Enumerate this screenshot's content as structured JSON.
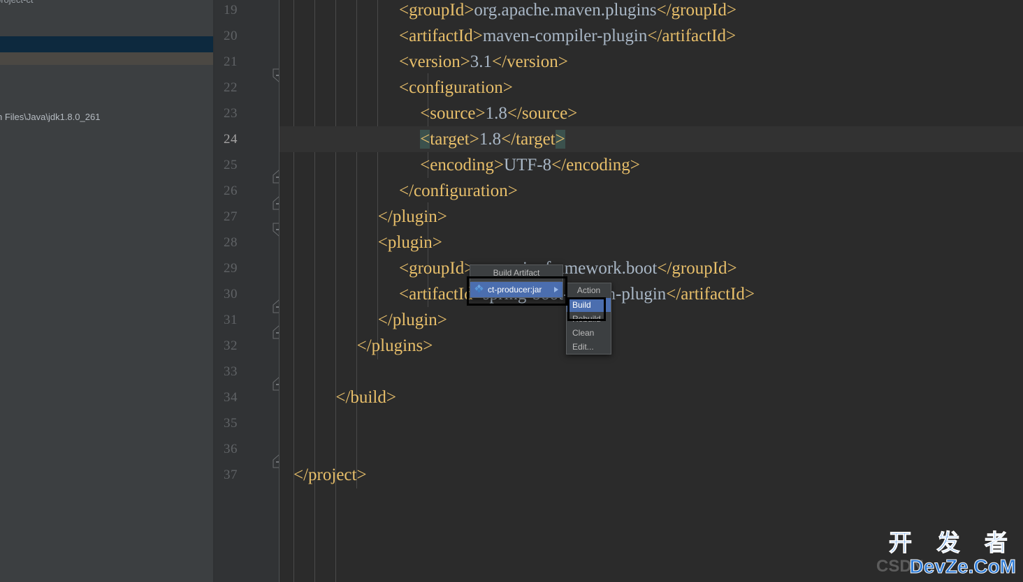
{
  "left_panel": {
    "clipped_tree_label": "project-ct",
    "sdk_path_label": "n Files\\Java\\jdk1.8.0_261"
  },
  "editor": {
    "lines": [
      {
        "num": "19",
        "indent": 5,
        "clipped": true,
        "segments": [
          {
            "t": "<groupId>",
            "c": "tag"
          },
          {
            "t": "org.apache.maven.plugins",
            "c": "txt"
          },
          {
            "t": "</groupId>",
            "c": "tag"
          }
        ]
      },
      {
        "num": "20",
        "indent": 5,
        "segments": [
          {
            "t": "<artifactId>",
            "c": "tag"
          },
          {
            "t": "maven-compiler-plugin",
            "c": "txt"
          },
          {
            "t": "</artifactId>",
            "c": "tag"
          }
        ]
      },
      {
        "num": "21",
        "indent": 5,
        "segments": [
          {
            "t": "<version>",
            "c": "tag"
          },
          {
            "t": "3.1",
            "c": "txt"
          },
          {
            "t": "</version>",
            "c": "tag"
          }
        ]
      },
      {
        "num": "22",
        "indent": 5,
        "segments": [
          {
            "t": "<configuration>",
            "c": "tag"
          }
        ]
      },
      {
        "num": "23",
        "indent": 6,
        "segments": [
          {
            "t": "<source>",
            "c": "tag"
          },
          {
            "t": "1.8",
            "c": "txt"
          },
          {
            "t": "</source>",
            "c": "tag"
          }
        ]
      },
      {
        "num": "24",
        "indent": 6,
        "current": true,
        "segments": [
          {
            "t": "<",
            "c": "tag",
            "hl": true
          },
          {
            "t": "target>",
            "c": "tag"
          },
          {
            "t": "1.8",
            "c": "txt"
          },
          {
            "t": "</target",
            "c": "tag"
          },
          {
            "t": ">",
            "c": "tag",
            "hl": true
          }
        ]
      },
      {
        "num": "25",
        "indent": 6,
        "segments": [
          {
            "t": "<encoding>",
            "c": "tag"
          },
          {
            "t": "UTF-8",
            "c": "txt"
          },
          {
            "t": "</encoding>",
            "c": "tag"
          }
        ]
      },
      {
        "num": "26",
        "indent": 5,
        "segments": [
          {
            "t": "</configuration>",
            "c": "tag"
          }
        ]
      },
      {
        "num": "27",
        "indent": 4,
        "segments": [
          {
            "t": "</plugin>",
            "c": "tag"
          }
        ]
      },
      {
        "num": "28",
        "indent": 4,
        "segments": [
          {
            "t": "<plugin>",
            "c": "tag"
          }
        ]
      },
      {
        "num": "29",
        "indent": 5,
        "segments": [
          {
            "t": "<groupId>",
            "c": "tag"
          },
          {
            "t": "org.springframework.boot",
            "c": "txt"
          },
          {
            "t": "</groupId>",
            "c": "tag"
          }
        ]
      },
      {
        "num": "30",
        "indent": 5,
        "segments": [
          {
            "t": "<artifactId>",
            "c": "tag"
          },
          {
            "t": "spring-boot-maven-plugin",
            "c": "txt"
          },
          {
            "t": "</artifactId>",
            "c": "tag"
          }
        ]
      },
      {
        "num": "31",
        "indent": 4,
        "segments": [
          {
            "t": "</plugin>",
            "c": "tag"
          }
        ]
      },
      {
        "num": "32",
        "indent": 3,
        "segments": [
          {
            "t": "</plugins>",
            "c": "tag"
          }
        ]
      },
      {
        "num": "33",
        "indent": 0,
        "segments": []
      },
      {
        "num": "34",
        "indent": 2,
        "segments": [
          {
            "t": "</build>",
            "c": "tag"
          }
        ]
      },
      {
        "num": "35",
        "indent": 0,
        "segments": []
      },
      {
        "num": "36",
        "indent": 0,
        "segments": []
      },
      {
        "num": "37",
        "indent": 0,
        "segments": [
          {
            "t": "</project>",
            "c": "tag"
          }
        ]
      }
    ],
    "fold_markers": [
      {
        "line": "22",
        "type": "collapse-start"
      },
      {
        "line": "26",
        "type": "collapse-end"
      },
      {
        "line": "27",
        "type": "collapse-end"
      },
      {
        "line": "28",
        "type": "collapse-start"
      },
      {
        "line": "31",
        "type": "collapse-end"
      },
      {
        "line": "32",
        "type": "collapse-end"
      },
      {
        "line": "34",
        "type": "collapse-end"
      },
      {
        "line": "37",
        "type": "collapse-end"
      }
    ]
  },
  "build_artifact_popup": {
    "title": "Build Artifact",
    "items": [
      {
        "label": "ct-producer:jar",
        "icon": "artifact-icon",
        "selected": true,
        "has_submenu": true
      }
    ]
  },
  "action_popup": {
    "title": "Action",
    "items": [
      {
        "label": "Build",
        "selected": true
      },
      {
        "label": "Rebuild",
        "selected": false
      },
      {
        "label": "Clean",
        "selected": false
      },
      {
        "label": "Edit...",
        "selected": false
      }
    ]
  },
  "watermark": {
    "cn": "开 发 者",
    "en": "DevZe.CoM",
    "bg": "CSDN"
  },
  "colors": {
    "accent_selection": "#4b6eaf",
    "tag": "#e8bf6a",
    "text": "#a9b7c6",
    "editor_bg": "#2b2b2b",
    "gutter_bg": "#313335",
    "panel_bg": "#3c3f41",
    "bracket_highlight": "#3b514d",
    "watermark_blue": "#2c7ad6"
  }
}
